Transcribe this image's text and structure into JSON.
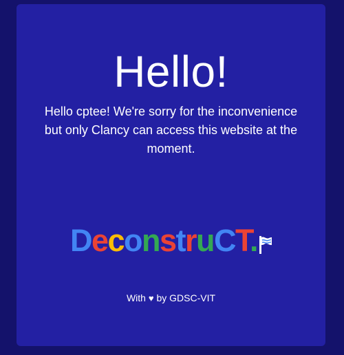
{
  "page": {
    "title": "Hello!",
    "message": "Hello cptee! We're sorry for the inconvenience but only Clancy can access this website at the moment."
  },
  "logo": {
    "text": "DeconstruCT.",
    "letter_colors": [
      "#4285F4",
      "#EA4335",
      "#FBBC05",
      "#4285F4",
      "#34A853",
      "#EA4335",
      "#4285F4",
      "#EA4335",
      "#34A853",
      "#4285F4",
      "#EA4335",
      "#34A853"
    ]
  },
  "footer": {
    "prefix": "With",
    "heart": "♥",
    "suffix": "by GDSC-VIT"
  },
  "colors": {
    "page_background": "#14126b",
    "card_background": "#2320a3",
    "text": "#ffffff"
  }
}
